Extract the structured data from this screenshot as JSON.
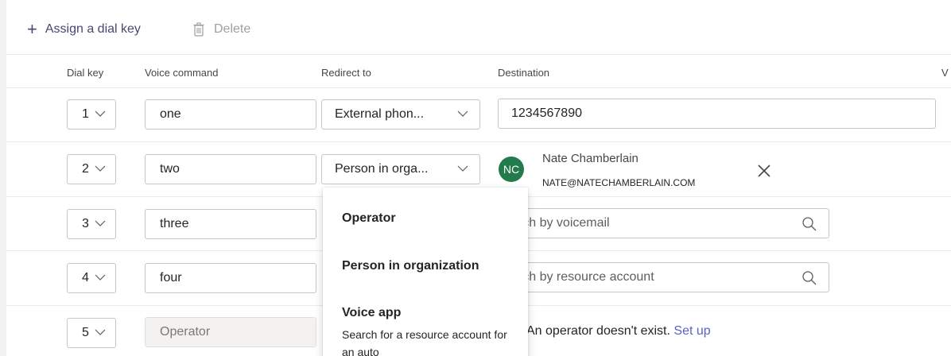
{
  "toolbar": {
    "assign_label": "Assign a dial key",
    "delete_label": "Delete"
  },
  "columns": {
    "dial_key": "Dial key",
    "voice_command": "Voice command",
    "redirect_to": "Redirect to",
    "destination": "Destination",
    "cut_off": "V"
  },
  "rows": [
    {
      "dial": "1",
      "voice": "one",
      "redirect": "External phon...",
      "destination_value": "1234567890"
    },
    {
      "dial": "2",
      "voice": "two",
      "redirect": "Person in orga...",
      "person": {
        "initials": "NC",
        "name": "Nate Chamberlain",
        "email": "NATE@NATECHAMBERLAIN.COM"
      }
    },
    {
      "dial": "3",
      "voice": "three",
      "destination_placeholder": "arch by voicemail"
    },
    {
      "dial": "4",
      "voice": "four",
      "destination_placeholder": "arch by resource account"
    },
    {
      "dial": "5",
      "voice": "Operator",
      "message": "An operator doesn't exist.",
      "message_link": "Set up"
    }
  ],
  "dropdown": {
    "options": [
      {
        "label": "Operator"
      },
      {
        "label": "Person in organization"
      },
      {
        "label": "Voice app",
        "description": "Search for a resource account for an auto"
      }
    ]
  },
  "colors": {
    "accent": "#464775",
    "link": "#5b5fc7",
    "avatar": "#237b4b"
  }
}
